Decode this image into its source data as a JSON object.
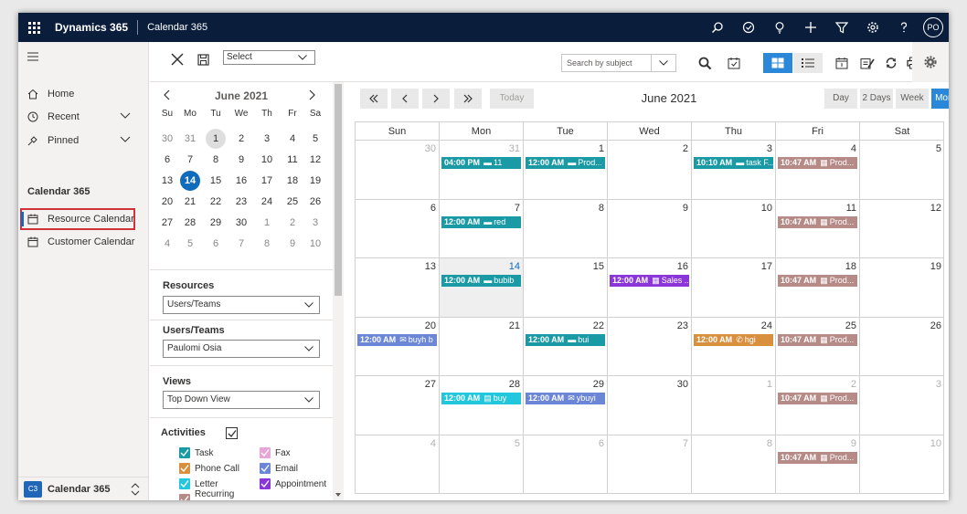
{
  "topbar": {
    "brand": "Dynamics 365",
    "app_name": "Calendar 365",
    "avatar_initials": "PO",
    "icons": [
      "search-icon",
      "target-icon",
      "lightbulb-icon",
      "plus-icon",
      "filter-icon",
      "gear-icon",
      "help-icon"
    ]
  },
  "nav": {
    "home": "Home",
    "recent": "Recent",
    "pinned": "Pinned",
    "section": "Calendar 365",
    "items": [
      "Resource Calendar",
      "Customer Calendar"
    ],
    "area_badge": "C3",
    "area_label": "Calendar 365"
  },
  "toolbar": {
    "select_value": "Select",
    "search_placeholder": "Search by subject"
  },
  "mini_calendar": {
    "title": "June 2021",
    "dow": [
      "Su",
      "Mo",
      "Tu",
      "We",
      "Th",
      "Fr",
      "Sa"
    ],
    "weeks": [
      [
        "30",
        "31",
        "1",
        "2",
        "3",
        "4",
        "5"
      ],
      [
        "6",
        "7",
        "8",
        "9",
        "10",
        "11",
        "12"
      ],
      [
        "13",
        "14",
        "15",
        "16",
        "17",
        "18",
        "19"
      ],
      [
        "20",
        "21",
        "22",
        "23",
        "24",
        "25",
        "26"
      ],
      [
        "27",
        "28",
        "29",
        "30",
        "1",
        "2",
        "3"
      ],
      [
        "4",
        "5",
        "6",
        "7",
        "8",
        "9",
        "10"
      ]
    ]
  },
  "filters": {
    "resources_label": "Resources",
    "resources_value": "Users/Teams",
    "users_label": "Users/Teams",
    "users_value": "Paulomi Osia",
    "views_label": "Views",
    "views_value": "Top Down View",
    "activities_label": "Activities",
    "activities": [
      {
        "label": "Task",
        "color": "#1a9aa5"
      },
      {
        "label": "Fax",
        "color": "#e8a6d6"
      },
      {
        "label": "Phone Call",
        "color": "#d8903e"
      },
      {
        "label": "Email",
        "color": "#6b86d6"
      },
      {
        "label": "Letter",
        "color": "#23c7dd"
      },
      {
        "label": "Appointment",
        "color": "#8a36d8"
      },
      {
        "label": "Recurring Appointment",
        "color": "#b68a86"
      }
    ]
  },
  "calendar": {
    "today_label": "Today",
    "title": "June 2021",
    "views": [
      "Day",
      "2 Days",
      "Week",
      "Month"
    ],
    "active_view": "Month",
    "dow": [
      "Sun",
      "Mon",
      "Tue",
      "Wed",
      "Thu",
      "Fri",
      "Sat"
    ],
    "weeks": [
      [
        "30",
        "31",
        "1",
        "2",
        "3",
        "4",
        "5"
      ],
      [
        "6",
        "7",
        "8",
        "9",
        "10",
        "11",
        "12"
      ],
      [
        "13",
        "14",
        "15",
        "16",
        "17",
        "18",
        "19"
      ],
      [
        "20",
        "21",
        "22",
        "23",
        "24",
        "25",
        "26"
      ],
      [
        "27",
        "28",
        "29",
        "30",
        "1",
        "2",
        "3"
      ],
      [
        "4",
        "5",
        "6",
        "7",
        "8",
        "9",
        "10"
      ]
    ],
    "events": [
      {
        "week": 0,
        "day": 1,
        "time": "04:00 PM",
        "title": "11",
        "icon": "task-icon",
        "glyph": "▬",
        "color": "#1a9aa5"
      },
      {
        "week": 0,
        "day": 2,
        "time": "12:00 AM",
        "title": "Prod...",
        "icon": "task-icon",
        "glyph": "▬",
        "color": "#1a9aa5"
      },
      {
        "week": 0,
        "day": 4,
        "time": "10:10 AM",
        "title": "task F...",
        "icon": "task-icon",
        "glyph": "▬",
        "color": "#1a9aa5"
      },
      {
        "week": 0,
        "day": 5,
        "time": "10:47 AM",
        "title": "Prod...",
        "icon": "recurring-icon",
        "glyph": "▦",
        "color": "#b68a86"
      },
      {
        "week": 1,
        "day": 1,
        "time": "12:00 AM",
        "title": "red",
        "icon": "task-icon",
        "glyph": "▬",
        "color": "#1a9aa5"
      },
      {
        "week": 1,
        "day": 5,
        "time": "10:47 AM",
        "title": "Prod...",
        "icon": "recurring-icon",
        "glyph": "▦",
        "color": "#b68a86"
      },
      {
        "week": 2,
        "day": 1,
        "time": "12:00 AM",
        "title": "bubib",
        "icon": "task-icon",
        "glyph": "▬",
        "color": "#1a9aa5"
      },
      {
        "week": 2,
        "day": 3,
        "time": "12:00 AM",
        "title": "Sales ...",
        "icon": "appointment-icon",
        "glyph": "▦",
        "color": "#8a36d8"
      },
      {
        "week": 2,
        "day": 5,
        "time": "10:47 AM",
        "title": "Prod...",
        "icon": "recurring-icon",
        "glyph": "▦",
        "color": "#b68a86"
      },
      {
        "week": 3,
        "day": 0,
        "time": "12:00 AM",
        "title": "buyh b",
        "icon": "email-icon",
        "glyph": "✉",
        "color": "#6b86d6"
      },
      {
        "week": 3,
        "day": 2,
        "time": "12:00 AM",
        "title": "bui",
        "icon": "task-icon",
        "glyph": "▬",
        "color": "#1a9aa5"
      },
      {
        "week": 3,
        "day": 4,
        "time": "12:00 AM",
        "title": "hgi",
        "icon": "phone-icon",
        "glyph": "✆",
        "color": "#d8903e"
      },
      {
        "week": 3,
        "day": 5,
        "time": "10:47 AM",
        "title": "Prod...",
        "icon": "recurring-icon",
        "glyph": "▦",
        "color": "#b68a86"
      },
      {
        "week": 4,
        "day": 1,
        "time": "12:00 AM",
        "title": "buy",
        "icon": "letter-icon",
        "glyph": "▤",
        "color": "#23c7dd"
      },
      {
        "week": 4,
        "day": 2,
        "time": "12:00 AM",
        "title": "ybuyi",
        "icon": "email-icon",
        "glyph": "✉",
        "color": "#6b86d6"
      },
      {
        "week": 4,
        "day": 5,
        "time": "10:47 AM",
        "title": "Prod...",
        "icon": "recurring-icon",
        "glyph": "▦",
        "color": "#b68a86"
      },
      {
        "week": 5,
        "day": 5,
        "time": "10:47 AM",
        "title": "Prod...",
        "icon": "recurring-icon",
        "glyph": "▦",
        "color": "#b68a86"
      }
    ]
  }
}
